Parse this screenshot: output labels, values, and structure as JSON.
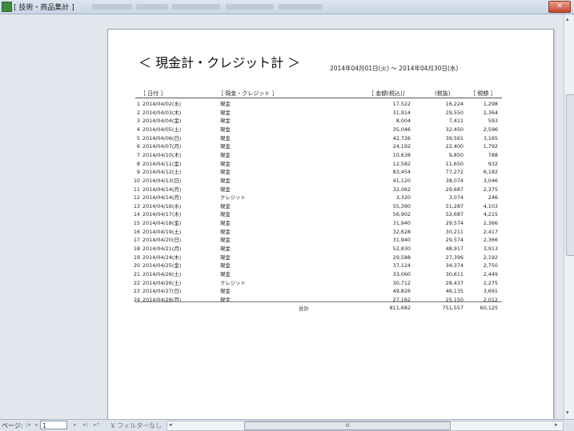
{
  "window": {
    "title": "[ 技術・商品集計 ]"
  },
  "report": {
    "title": "＜ 現金計・クレジット計 ＞",
    "date_range": "2014年04月01日(火) ～ 2014年04月30日(水)",
    "headers": {
      "date": "［ 日付 ］",
      "type": "［ 現金・クレジット ］",
      "amount": "［ 金額(税込)］",
      "net": "(税抜)",
      "tax": "［ 税額 ］"
    },
    "rows": [
      {
        "no": "1",
        "date": "2014/04/02(水)",
        "type": "現金",
        "amount": "17,522",
        "net": "16,224",
        "tax": "1,298"
      },
      {
        "no": "2",
        "date": "2014/04/03(木)",
        "type": "現金",
        "amount": "31,914",
        "net": "29,550",
        "tax": "2,364"
      },
      {
        "no": "3",
        "date": "2014/04/04(金)",
        "type": "現金",
        "amount": "8,004",
        "net": "7,411",
        "tax": "593"
      },
      {
        "no": "4",
        "date": "2014/04/05(土)",
        "type": "現金",
        "amount": "35,046",
        "net": "32,450",
        "tax": "2,596"
      },
      {
        "no": "5",
        "date": "2014/04/06(日)",
        "type": "現金",
        "amount": "42,726",
        "net": "39,561",
        "tax": "3,165"
      },
      {
        "no": "6",
        "date": "2014/04/07(月)",
        "type": "現金",
        "amount": "24,192",
        "net": "22,400",
        "tax": "1,792"
      },
      {
        "no": "7",
        "date": "2014/04/10(木)",
        "type": "現金",
        "amount": "10,638",
        "net": "9,850",
        "tax": "788"
      },
      {
        "no": "8",
        "date": "2014/04/11(金)",
        "type": "現金",
        "amount": "12,582",
        "net": "11,650",
        "tax": "932"
      },
      {
        "no": "9",
        "date": "2014/04/12(土)",
        "type": "現金",
        "amount": "83,454",
        "net": "77,272",
        "tax": "6,182"
      },
      {
        "no": "10",
        "date": "2014/04/13(日)",
        "type": "現金",
        "amount": "41,120",
        "net": "38,074",
        "tax": "3,046"
      },
      {
        "no": "11",
        "date": "2014/04/14(月)",
        "type": "現金",
        "amount": "32,062",
        "net": "29,687",
        "tax": "2,375"
      },
      {
        "no": "12",
        "date": "2014/04/14(月)",
        "type": "クレジット",
        "amount": "3,320",
        "net": "3,074",
        "tax": "246"
      },
      {
        "no": "13",
        "date": "2014/04/16(水)",
        "type": "現金",
        "amount": "55,390",
        "net": "51,287",
        "tax": "4,103"
      },
      {
        "no": "14",
        "date": "2014/04/17(木)",
        "type": "現金",
        "amount": "56,902",
        "net": "52,687",
        "tax": "4,215"
      },
      {
        "no": "15",
        "date": "2014/04/18(金)",
        "type": "現金",
        "amount": "31,940",
        "net": "29,574",
        "tax": "2,366"
      },
      {
        "no": "16",
        "date": "2014/04/19(土)",
        "type": "現金",
        "amount": "32,628",
        "net": "30,211",
        "tax": "2,417"
      },
      {
        "no": "17",
        "date": "2014/04/20(日)",
        "type": "現金",
        "amount": "31,940",
        "net": "29,574",
        "tax": "2,366"
      },
      {
        "no": "18",
        "date": "2014/04/21(月)",
        "type": "現金",
        "amount": "52,830",
        "net": "48,917",
        "tax": "3,913"
      },
      {
        "no": "19",
        "date": "2014/04/24(木)",
        "type": "現金",
        "amount": "29,588",
        "net": "27,396",
        "tax": "2,192"
      },
      {
        "no": "20",
        "date": "2014/04/25(金)",
        "type": "現金",
        "amount": "37,124",
        "net": "34,374",
        "tax": "2,750"
      },
      {
        "no": "21",
        "date": "2014/04/26(土)",
        "type": "現金",
        "amount": "33,060",
        "net": "30,611",
        "tax": "2,449"
      },
      {
        "no": "22",
        "date": "2014/04/26(土)",
        "type": "クレジット",
        "amount": "30,712",
        "net": "28,437",
        "tax": "2,275"
      },
      {
        "no": "23",
        "date": "2014/04/27(日)",
        "type": "現金",
        "amount": "49,826",
        "net": "46,135",
        "tax": "3,691"
      },
      {
        "no": "24",
        "date": "2014/04/28(月)",
        "type": "現金",
        "amount": "27,162",
        "net": "25,150",
        "tax": "2,012"
      }
    ],
    "total": {
      "label": "合計",
      "amount": "811,682",
      "net": "751,557",
      "tax": "60,125"
    }
  },
  "statusbar": {
    "page_label": "ページ:",
    "page_value": "1",
    "nav_first": "|◂",
    "nav_prev": "◂",
    "nav_next": "▸",
    "nav_last": "▸|",
    "filter_label": "フィルターなし",
    "hscroll_left": "◂",
    "hscroll_right": "▸",
    "hscroll_grip": "III"
  },
  "icons": {
    "app": "access-report-icon",
    "close": "close-icon"
  }
}
